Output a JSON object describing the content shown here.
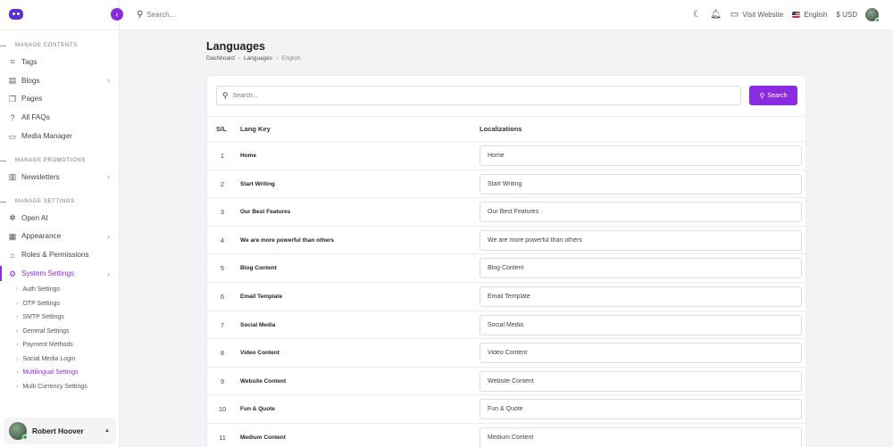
{
  "topbar": {
    "search_placeholder": "Search...",
    "visit_website": "Visit Website",
    "language": "English",
    "currency": "$ USD"
  },
  "sidebar": {
    "sections": {
      "contents": "MANAGE CONTENTS",
      "promotions": "MANAGE PROMOTIONS",
      "settings": "MANAGE SETTINGS"
    },
    "contents_items": [
      {
        "label": "Tags",
        "icon": "tag-icon"
      },
      {
        "label": "Blogs",
        "icon": "file-icon"
      },
      {
        "label": "Pages",
        "icon": "pages-icon"
      },
      {
        "label": "All FAQs",
        "icon": "question-icon"
      },
      {
        "label": "Media Manager",
        "icon": "folder-icon"
      }
    ],
    "promotions_items": [
      {
        "label": "Newsletters",
        "icon": "book-icon"
      }
    ],
    "settings_items": [
      {
        "label": "Open AI",
        "icon": "openai-icon"
      },
      {
        "label": "Appearance",
        "icon": "layout-icon"
      },
      {
        "label": "Roles & Permissions",
        "icon": "lock-icon"
      },
      {
        "label": "System Settings",
        "icon": "gear-icon"
      }
    ],
    "system_sub": [
      "Auth Settings",
      "OTP Settings",
      "SMTP Settings",
      "General Settings",
      "Payment Methods",
      "Social Media Login",
      "Multilingual Settings",
      "Multi Currency Settings"
    ],
    "user": {
      "name": "Robert Hoover"
    }
  },
  "page": {
    "title": "Languages",
    "breadcrumb": [
      "Dashboard",
      "Languages",
      "English"
    ],
    "search_placeholder": "Search...",
    "search_button": "Search",
    "columns": {
      "sl": "S/L",
      "key": "Lang Key",
      "loc": "Localizations"
    },
    "rows": [
      {
        "sl": "1",
        "key": "Home",
        "value": "Home"
      },
      {
        "sl": "2",
        "key": "Start Writing",
        "value": "Start Writing"
      },
      {
        "sl": "3",
        "key": "Our Best Features",
        "value": "Our Best Features"
      },
      {
        "sl": "4",
        "key": "We are more powerful than others",
        "value": "We are more powerful than others"
      },
      {
        "sl": "5",
        "key": "Blog Content",
        "value": "Blog Content"
      },
      {
        "sl": "6",
        "key": "Email Template",
        "value": "Email Template"
      },
      {
        "sl": "7",
        "key": "Social Media",
        "value": "Social Media"
      },
      {
        "sl": "8",
        "key": "Video Content",
        "value": "Video Content"
      },
      {
        "sl": "9",
        "key": "Website Content",
        "value": "Website Content"
      },
      {
        "sl": "10",
        "key": "Fun & Quote",
        "value": "Fun & Quote"
      },
      {
        "sl": "11",
        "key": "Medium Content",
        "value": "Medium Content"
      }
    ]
  },
  "colors": {
    "accent": "#8a2be2",
    "logo": "#5b2fd1"
  }
}
